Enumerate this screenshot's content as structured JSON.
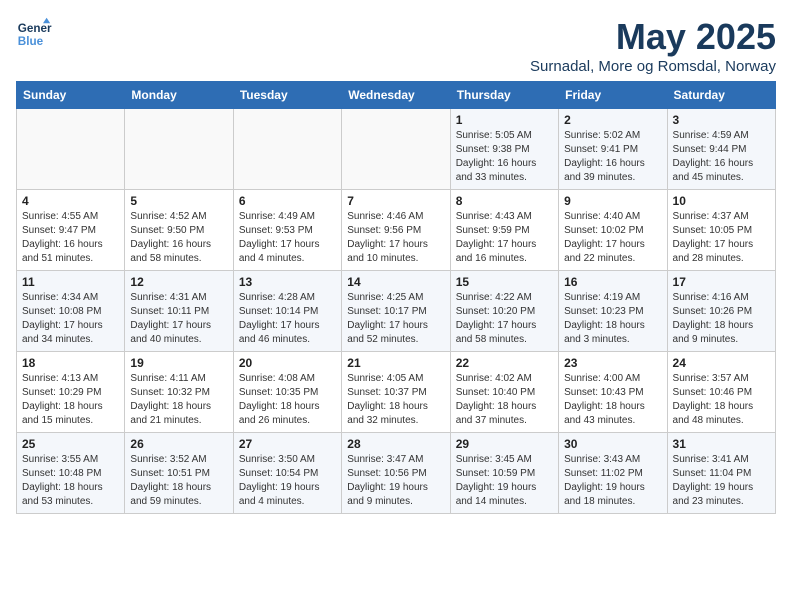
{
  "header": {
    "logo_line1": "General",
    "logo_line2": "Blue",
    "month": "May 2025",
    "location": "Surnadal, More og Romsdal, Norway"
  },
  "weekdays": [
    "Sunday",
    "Monday",
    "Tuesday",
    "Wednesday",
    "Thursday",
    "Friday",
    "Saturday"
  ],
  "weeks": [
    [
      {
        "day": "",
        "info": ""
      },
      {
        "day": "",
        "info": ""
      },
      {
        "day": "",
        "info": ""
      },
      {
        "day": "",
        "info": ""
      },
      {
        "day": "1",
        "info": "Sunrise: 5:05 AM\nSunset: 9:38 PM\nDaylight: 16 hours\nand 33 minutes."
      },
      {
        "day": "2",
        "info": "Sunrise: 5:02 AM\nSunset: 9:41 PM\nDaylight: 16 hours\nand 39 minutes."
      },
      {
        "day": "3",
        "info": "Sunrise: 4:59 AM\nSunset: 9:44 PM\nDaylight: 16 hours\nand 45 minutes."
      }
    ],
    [
      {
        "day": "4",
        "info": "Sunrise: 4:55 AM\nSunset: 9:47 PM\nDaylight: 16 hours\nand 51 minutes."
      },
      {
        "day": "5",
        "info": "Sunrise: 4:52 AM\nSunset: 9:50 PM\nDaylight: 16 hours\nand 58 minutes."
      },
      {
        "day": "6",
        "info": "Sunrise: 4:49 AM\nSunset: 9:53 PM\nDaylight: 17 hours\nand 4 minutes."
      },
      {
        "day": "7",
        "info": "Sunrise: 4:46 AM\nSunset: 9:56 PM\nDaylight: 17 hours\nand 10 minutes."
      },
      {
        "day": "8",
        "info": "Sunrise: 4:43 AM\nSunset: 9:59 PM\nDaylight: 17 hours\nand 16 minutes."
      },
      {
        "day": "9",
        "info": "Sunrise: 4:40 AM\nSunset: 10:02 PM\nDaylight: 17 hours\nand 22 minutes."
      },
      {
        "day": "10",
        "info": "Sunrise: 4:37 AM\nSunset: 10:05 PM\nDaylight: 17 hours\nand 28 minutes."
      }
    ],
    [
      {
        "day": "11",
        "info": "Sunrise: 4:34 AM\nSunset: 10:08 PM\nDaylight: 17 hours\nand 34 minutes."
      },
      {
        "day": "12",
        "info": "Sunrise: 4:31 AM\nSunset: 10:11 PM\nDaylight: 17 hours\nand 40 minutes."
      },
      {
        "day": "13",
        "info": "Sunrise: 4:28 AM\nSunset: 10:14 PM\nDaylight: 17 hours\nand 46 minutes."
      },
      {
        "day": "14",
        "info": "Sunrise: 4:25 AM\nSunset: 10:17 PM\nDaylight: 17 hours\nand 52 minutes."
      },
      {
        "day": "15",
        "info": "Sunrise: 4:22 AM\nSunset: 10:20 PM\nDaylight: 17 hours\nand 58 minutes."
      },
      {
        "day": "16",
        "info": "Sunrise: 4:19 AM\nSunset: 10:23 PM\nDaylight: 18 hours\nand 3 minutes."
      },
      {
        "day": "17",
        "info": "Sunrise: 4:16 AM\nSunset: 10:26 PM\nDaylight: 18 hours\nand 9 minutes."
      }
    ],
    [
      {
        "day": "18",
        "info": "Sunrise: 4:13 AM\nSunset: 10:29 PM\nDaylight: 18 hours\nand 15 minutes."
      },
      {
        "day": "19",
        "info": "Sunrise: 4:11 AM\nSunset: 10:32 PM\nDaylight: 18 hours\nand 21 minutes."
      },
      {
        "day": "20",
        "info": "Sunrise: 4:08 AM\nSunset: 10:35 PM\nDaylight: 18 hours\nand 26 minutes."
      },
      {
        "day": "21",
        "info": "Sunrise: 4:05 AM\nSunset: 10:37 PM\nDaylight: 18 hours\nand 32 minutes."
      },
      {
        "day": "22",
        "info": "Sunrise: 4:02 AM\nSunset: 10:40 PM\nDaylight: 18 hours\nand 37 minutes."
      },
      {
        "day": "23",
        "info": "Sunrise: 4:00 AM\nSunset: 10:43 PM\nDaylight: 18 hours\nand 43 minutes."
      },
      {
        "day": "24",
        "info": "Sunrise: 3:57 AM\nSunset: 10:46 PM\nDaylight: 18 hours\nand 48 minutes."
      }
    ],
    [
      {
        "day": "25",
        "info": "Sunrise: 3:55 AM\nSunset: 10:48 PM\nDaylight: 18 hours\nand 53 minutes."
      },
      {
        "day": "26",
        "info": "Sunrise: 3:52 AM\nSunset: 10:51 PM\nDaylight: 18 hours\nand 59 minutes."
      },
      {
        "day": "27",
        "info": "Sunrise: 3:50 AM\nSunset: 10:54 PM\nDaylight: 19 hours\nand 4 minutes."
      },
      {
        "day": "28",
        "info": "Sunrise: 3:47 AM\nSunset: 10:56 PM\nDaylight: 19 hours\nand 9 minutes."
      },
      {
        "day": "29",
        "info": "Sunrise: 3:45 AM\nSunset: 10:59 PM\nDaylight: 19 hours\nand 14 minutes."
      },
      {
        "day": "30",
        "info": "Sunrise: 3:43 AM\nSunset: 11:02 PM\nDaylight: 19 hours\nand 18 minutes."
      },
      {
        "day": "31",
        "info": "Sunrise: 3:41 AM\nSunset: 11:04 PM\nDaylight: 19 hours\nand 23 minutes."
      }
    ]
  ]
}
